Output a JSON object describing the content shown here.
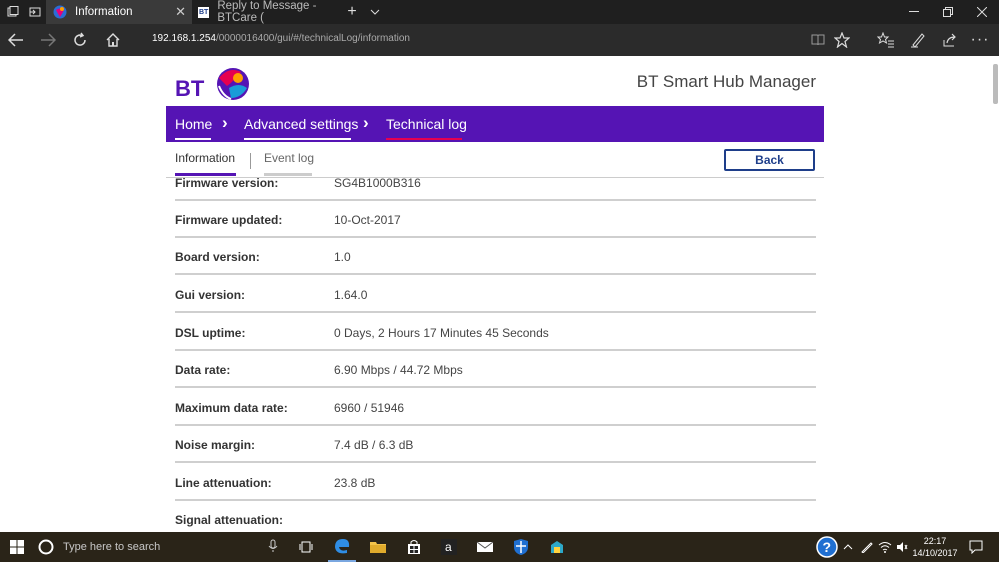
{
  "browser": {
    "tabs": [
      {
        "title": "Information",
        "active": true
      },
      {
        "title": "Reply to Message - BTCare (",
        "active": false
      }
    ],
    "address": {
      "host": "192.168.1.254",
      "path": "/0000016400/gui/#/technicalLog/information"
    },
    "icons": [
      "back-arrow-icon",
      "forward-arrow-icon",
      "refresh-icon",
      "home-icon",
      "reading-view-icon",
      "favorite-star-icon",
      "favorites-hub-icon",
      "pen-icon",
      "share-icon",
      "more-dots-icon"
    ]
  },
  "page": {
    "logo_text": "BT",
    "hub_title": "BT Smart Hub Manager",
    "breadcrumb": [
      {
        "label": "Home"
      },
      {
        "label": "Advanced settings"
      },
      {
        "label": "Technical log"
      }
    ],
    "subtabs": {
      "information": "Information",
      "event_log": "Event log"
    },
    "back_label": "Back",
    "rows": [
      {
        "label": "Firmware version:",
        "value": "SG4B1000B316"
      },
      {
        "label": "Firmware updated:",
        "value": "10-Oct-2017"
      },
      {
        "label": "Board version:",
        "value": "1.0"
      },
      {
        "label": "Gui version:",
        "value": "1.64.0"
      },
      {
        "label": "DSL uptime:",
        "value": "0 Days, 2 Hours 17 Minutes 45 Seconds"
      },
      {
        "label": "Data rate:",
        "value": "6.90 Mbps / 44.72 Mbps"
      },
      {
        "label": "Maximum data rate:",
        "value": "6960 / 51946"
      },
      {
        "label": "Noise margin:",
        "value": "7.4 dB / 6.3 dB"
      },
      {
        "label": "Line attenuation:",
        "value": "23.8 dB"
      },
      {
        "label": "Signal attenuation:",
        "value": ""
      }
    ],
    "colors": {
      "brand_purple": "#5514b4",
      "brand_pink": "#e60050",
      "button_blue": "#1e3e8a"
    }
  },
  "taskbar": {
    "search_placeholder": "Type here to search",
    "time": "22:17",
    "date": "14/10/2017"
  }
}
